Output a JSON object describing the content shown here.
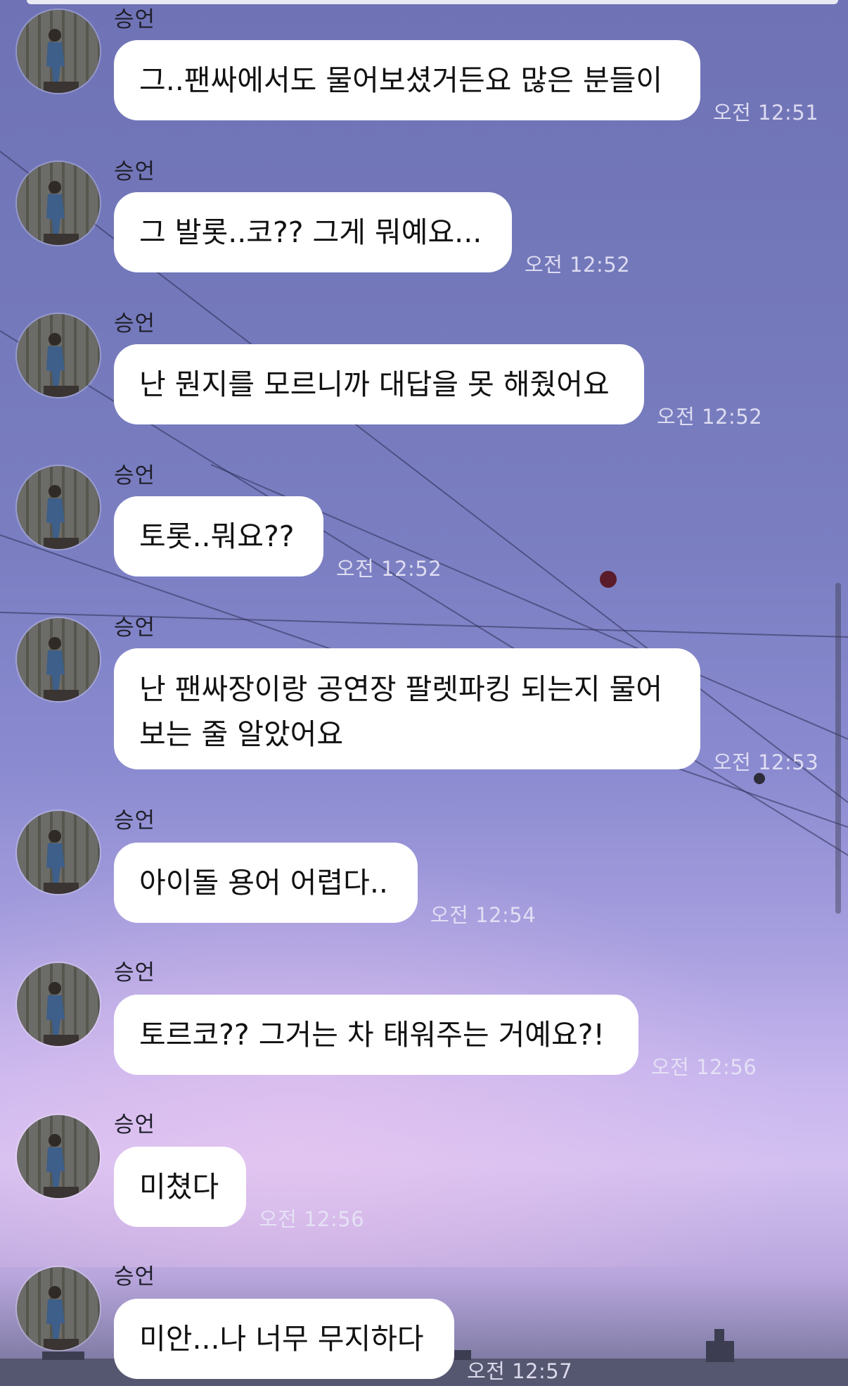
{
  "chat": {
    "messages": [
      {
        "sender": "승언",
        "text": "그..팬싸에서도 물어보셨거든요 많은 분들이",
        "time": "오전 12:51"
      },
      {
        "sender": "승언",
        "text": "그 발롯..코?? 그게 뭐예요...",
        "time": "오전 12:52"
      },
      {
        "sender": "승언",
        "text": "난 뭔지를 모르니까 대답을 못 해줬어요",
        "time": "오전 12:52"
      },
      {
        "sender": "승언",
        "text": "토롯..뭐요??",
        "time": "오전 12:52"
      },
      {
        "sender": "승언",
        "line1": "난 팬싸장이랑 공연장 팔렛파킹 되는지 물어",
        "line2": "보는 줄 알았어요",
        "time": "오전 12:53"
      },
      {
        "sender": "승언",
        "text": "아이돌 용어 어렵다..",
        "time": "오전 12:54"
      },
      {
        "sender": "승언",
        "text": "토르코?? 그거는 차 태워주는 거예요?!",
        "time": "오전 12:56"
      },
      {
        "sender": "승언",
        "text": "미쳤다",
        "time": "오전 12:56"
      },
      {
        "sender": "승언",
        "text": "미안...나 너무 무지하다",
        "time": "오전 12:57"
      }
    ]
  },
  "icons": {
    "avatar": "profile-photo-person-standing",
    "scrollbar": "scrollbar-thumb"
  },
  "colors": {
    "bubble": "#ffffff",
    "timestamp": "#e6e4f5",
    "sender_name": "#1f1f2a"
  }
}
